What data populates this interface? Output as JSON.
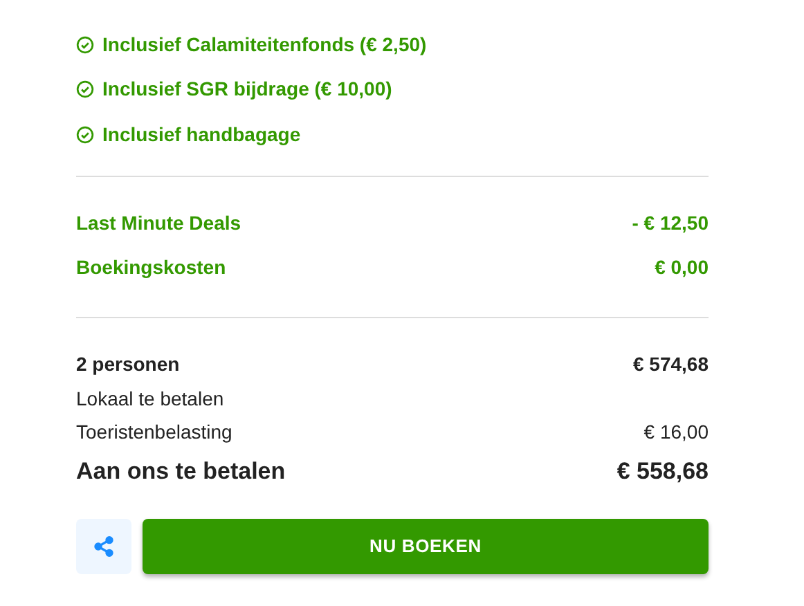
{
  "inclusions": [
    "Inclusief Calamiteitenfonds (€ 2,50)",
    "Inclusief SGR bijdrage (€ 10,00)",
    "Inclusief handbagage"
  ],
  "discounts": [
    {
      "label": "Last Minute Deals",
      "amount": "- € 12,50"
    },
    {
      "label": "Boekingskosten",
      "amount": "€ 0,00"
    }
  ],
  "totals": [
    {
      "kind": "bold",
      "label": "2 personen",
      "amount": "€ 574,68"
    },
    {
      "kind": "plain",
      "label": "Lokaal te betalen"
    },
    {
      "kind": "plain",
      "label": "Toeristenbelasting",
      "amount": "€ 16,00"
    },
    {
      "kind": "total",
      "label": "Aan ons te betalen",
      "amount": "€ 558,68"
    }
  ],
  "book_button": "NU BOEKEN"
}
